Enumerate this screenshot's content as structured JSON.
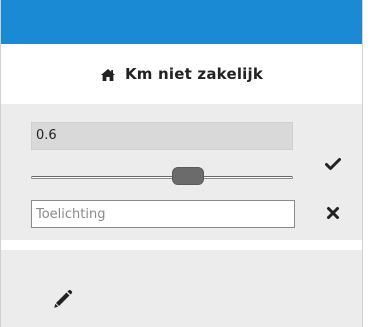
{
  "header": {
    "title": "Km niet zakelijk",
    "home_icon": "home-icon"
  },
  "form": {
    "value": "0.6",
    "slider": {
      "value": 0.6,
      "min": 0,
      "max": 1
    },
    "note": {
      "value": "",
      "placeholder": "Toelichting"
    },
    "actions": {
      "confirm_icon": "check-icon",
      "cancel_icon": "close-icon"
    }
  },
  "footer": {
    "edit_icon": "pencil-icon"
  },
  "colors": {
    "topbar": "#1a8ad4",
    "panel_bg": "#ececec",
    "text": "#222222"
  }
}
